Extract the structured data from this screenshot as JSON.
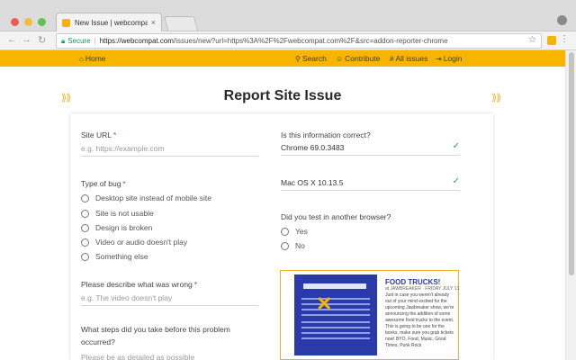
{
  "browser": {
    "tab_title": "New Issue | webcompat.com",
    "tab_close": "×",
    "secure_label": "Secure",
    "url_domain": "https://webcompat.com",
    "url_path": "/issues/new?url=https%3A%2F%2Fwebcompat.com%2F&src=addon-reporter-chrome"
  },
  "nav": {
    "home": "Home",
    "search": "Search",
    "contribute": "Contribute",
    "all_issues": "All issues",
    "login": "Login"
  },
  "page": {
    "title": "Report Site Issue",
    "deco_left": "⟫⟫",
    "deco_right": "⟫⟫"
  },
  "form": {
    "site_url_label": "Site URL",
    "site_url_placeholder": "e.g. https://example.com",
    "required_mark": "*",
    "bug_type_label": "Type of bug",
    "bug_types": [
      "Desktop site instead of mobile site",
      "Site is not usable",
      "Design is broken",
      "Video or audio doesn't play",
      "Something else"
    ],
    "describe_label": "Please describe what was wrong",
    "describe_placeholder": "e.g. The video doesn't play",
    "steps_label_line1": "What steps did you take before this problem",
    "steps_label_line2": "occurred?",
    "steps_placeholder": "Please be as detailed as possible",
    "info_correct_label": "Is this information correct?",
    "browser_value": "Chrome 69.0.3483",
    "os_value": "Mac OS X 10.13.5",
    "check_glyph": "✓",
    "tested_label": "Did you test in another browser?",
    "tested_options": [
      "Yes",
      "No"
    ]
  },
  "ad": {
    "title": "FOOD TRUCKS!",
    "subtitle": "at JAWBREAKER · FRIDAY JULY 13",
    "text": "Just in case you weren't already out of your mind excited for the upcoming Jawbreaker show, we're announcing the addition of some awesome food trucks to the event. This is going to be one for the books, make sure you grab tickets now! BYO, Food, Music, Good Times, Punk Rock"
  },
  "colors": {
    "nav_bg": "#f8b500",
    "accent": "#e9b42c",
    "required": "#e3342f",
    "check": "#2ea44f",
    "secure": "#0f9d58"
  },
  "icons": {
    "home": "home-icon",
    "search": "search-icon",
    "contribute": "people-icon",
    "issues": "hash-icon",
    "login": "login-icon"
  }
}
